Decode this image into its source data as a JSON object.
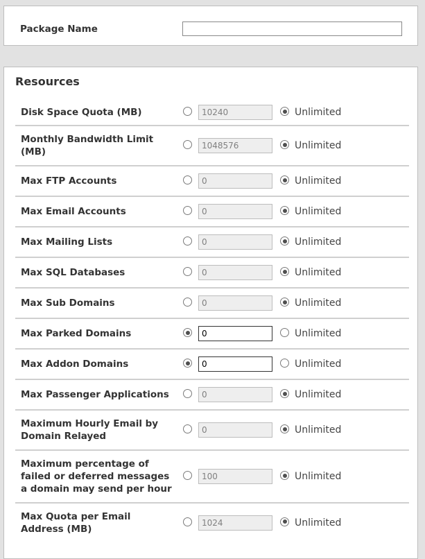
{
  "package": {
    "label": "Package Name",
    "value": ""
  },
  "resources": {
    "title": "Resources",
    "unlimited_label": "Unlimited",
    "rows": [
      {
        "label": "Disk Space Quota (MB)",
        "value": "10240",
        "unlimited": true
      },
      {
        "label": "Monthly Bandwidth Limit (MB)",
        "value": "1048576",
        "unlimited": true
      },
      {
        "label": "Max FTP Accounts",
        "value": "0",
        "unlimited": true
      },
      {
        "label": "Max Email Accounts",
        "value": "0",
        "unlimited": true
      },
      {
        "label": "Max Mailing Lists",
        "value": "0",
        "unlimited": true
      },
      {
        "label": "Max SQL Databases",
        "value": "0",
        "unlimited": true
      },
      {
        "label": "Max Sub Domains",
        "value": "0",
        "unlimited": true
      },
      {
        "label": "Max Parked Domains",
        "value": "0",
        "unlimited": false
      },
      {
        "label": "Max Addon Domains",
        "value": "0",
        "unlimited": false
      },
      {
        "label": "Max Passenger Applications",
        "value": "0",
        "unlimited": true
      },
      {
        "label": "Maximum Hourly Email by Domain Relayed",
        "value": "0",
        "unlimited": true
      },
      {
        "label": "Maximum percentage of failed or deferred messages a domain may send per hour",
        "value": "100",
        "unlimited": true
      },
      {
        "label": "Max Quota per Email Address (MB)",
        "value": "1024",
        "unlimited": true
      }
    ]
  }
}
